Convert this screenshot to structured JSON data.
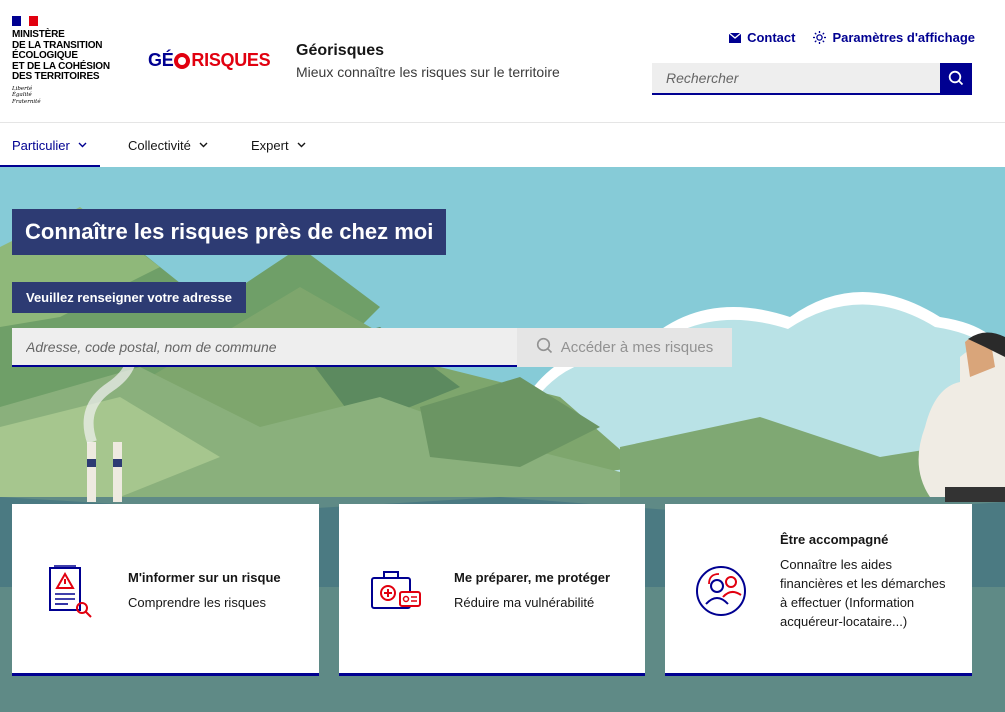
{
  "header": {
    "ministry_lines": [
      "Ministère",
      "de la transition",
      "écologique",
      "et de la cohésion",
      "des territoires"
    ],
    "motto": [
      "Liberté",
      "Égalité",
      "Fraternité"
    ],
    "logo_part1": "GÉ",
    "logo_part2": "RISQUES",
    "site_title": "Géorisques",
    "site_tagline": "Mieux connaître les risques sur le territoire",
    "quicklinks": [
      {
        "label": "Contact",
        "icon": "mail-icon"
      },
      {
        "label": "Paramètres d'affichage",
        "icon": "sun-icon"
      }
    ],
    "search_placeholder": "Rechercher"
  },
  "nav": [
    {
      "label": "Particulier",
      "active": true
    },
    {
      "label": "Collectivité",
      "active": false
    },
    {
      "label": "Expert",
      "active": false
    }
  ],
  "hero": {
    "title": "Connaître les risques près de chez moi",
    "address_label": "Veuillez renseigner votre adresse",
    "address_placeholder": "Adresse, code postal, nom de commune",
    "address_button": "Accéder à mes risques"
  },
  "cards": [
    {
      "title": "M'informer sur un risque",
      "desc": "Comprendre les risques",
      "icon": "document-warning-icon"
    },
    {
      "title": "Me préparer, me protéger",
      "desc": "Réduire ma vulnérabilité",
      "icon": "emergency-kit-icon"
    },
    {
      "title": "Être accompagné",
      "desc": "Connaître les aides financières et les démarches à effectuer (Information acquéreur-locataire...)",
      "icon": "support-people-icon"
    }
  ],
  "colors": {
    "primary": "#000091",
    "accent_red": "#e1000f",
    "hero_label_bg": "#2d3b73"
  }
}
